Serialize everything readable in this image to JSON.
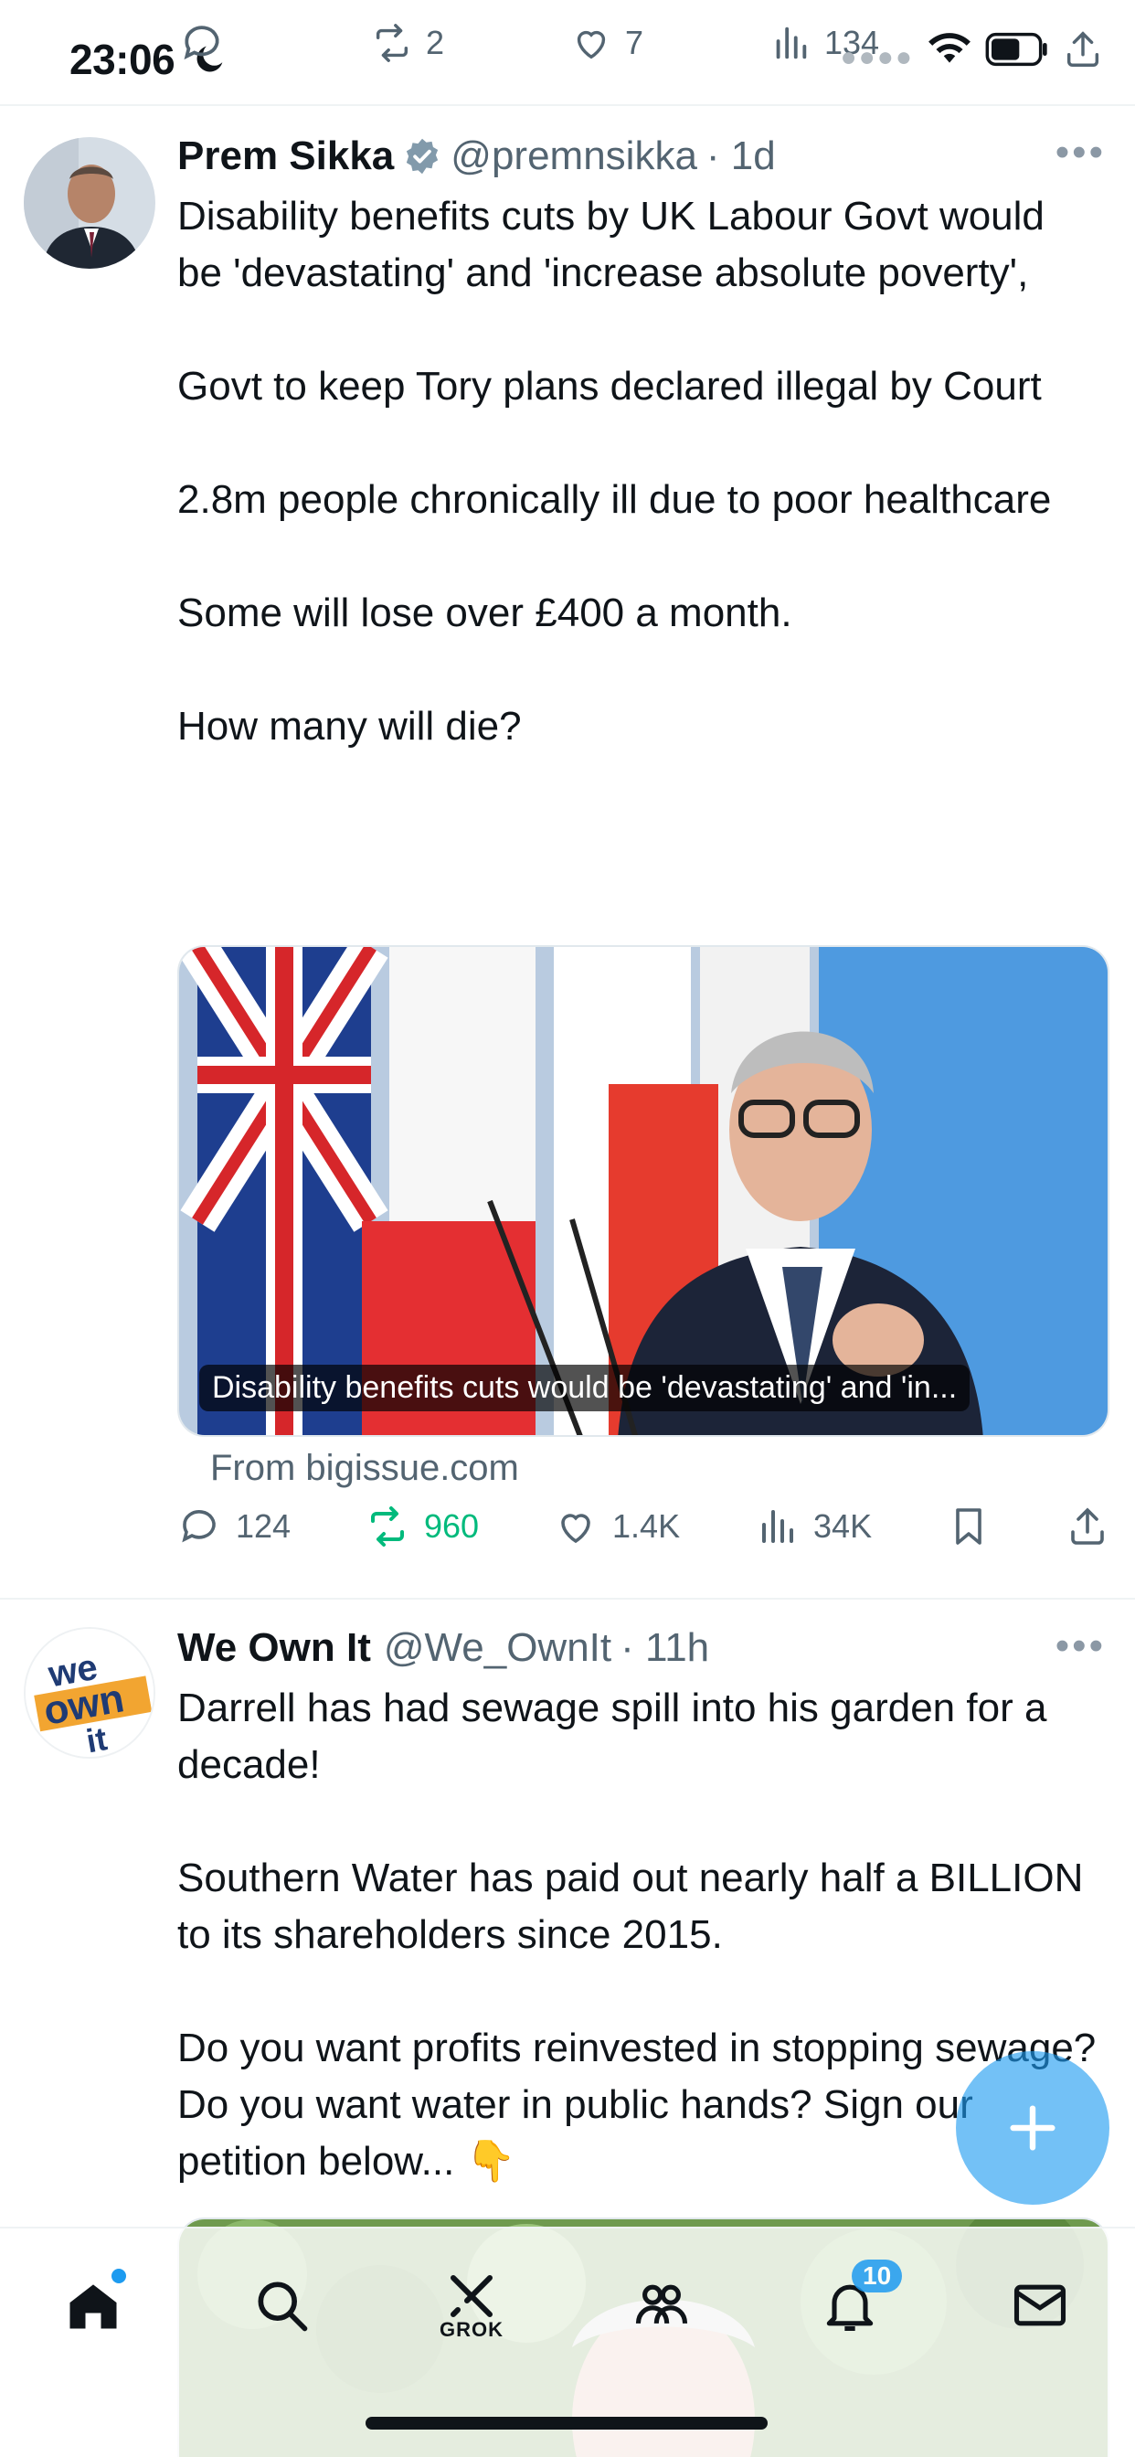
{
  "status_bar": {
    "time": "23:06"
  },
  "previous_tweet_actions": {
    "retweets": "2",
    "likes": "7",
    "views": "134"
  },
  "tweets": [
    {
      "name": "Prem Sikka",
      "handle": "@premnsikka",
      "time": "· 1d",
      "verified": true,
      "text": "Disability benefits cuts by UK Labour Govt would be 'devastating' and 'increase absolute poverty',\n\nGovt to keep Tory plans declared illegal by Court\n\n2.8m people chronically ill due to poor healthcare\n\nSome will lose over £400 a month.\n\nHow many will die?",
      "card": {
        "caption": "Disability benefits cuts would be 'devastating' and 'in...",
        "source": "From bigissue.com"
      },
      "actions": {
        "replies": "124",
        "retweets": "960",
        "likes": "1.4K",
        "views": "34K"
      }
    },
    {
      "name": "We Own It",
      "handle": "@We_OwnIt",
      "time": "· 11h",
      "avatar_text": "we own it",
      "text": "Darrell has had sewage spill into his garden for a decade!\n\nSouthern Water has paid out nearly half a BILLION to its shareholders since 2015.\n\nDo you want profits reinvested in stopping sewage? Do you want water in public hands? Sign our petition below... 👇"
    }
  ],
  "bottom_nav": {
    "grok_label": "GROK",
    "notifications_badge": "10"
  },
  "colors": {
    "accent": "#1d9bf0",
    "retweet_active": "#00ba7c",
    "muted": "#536471"
  }
}
